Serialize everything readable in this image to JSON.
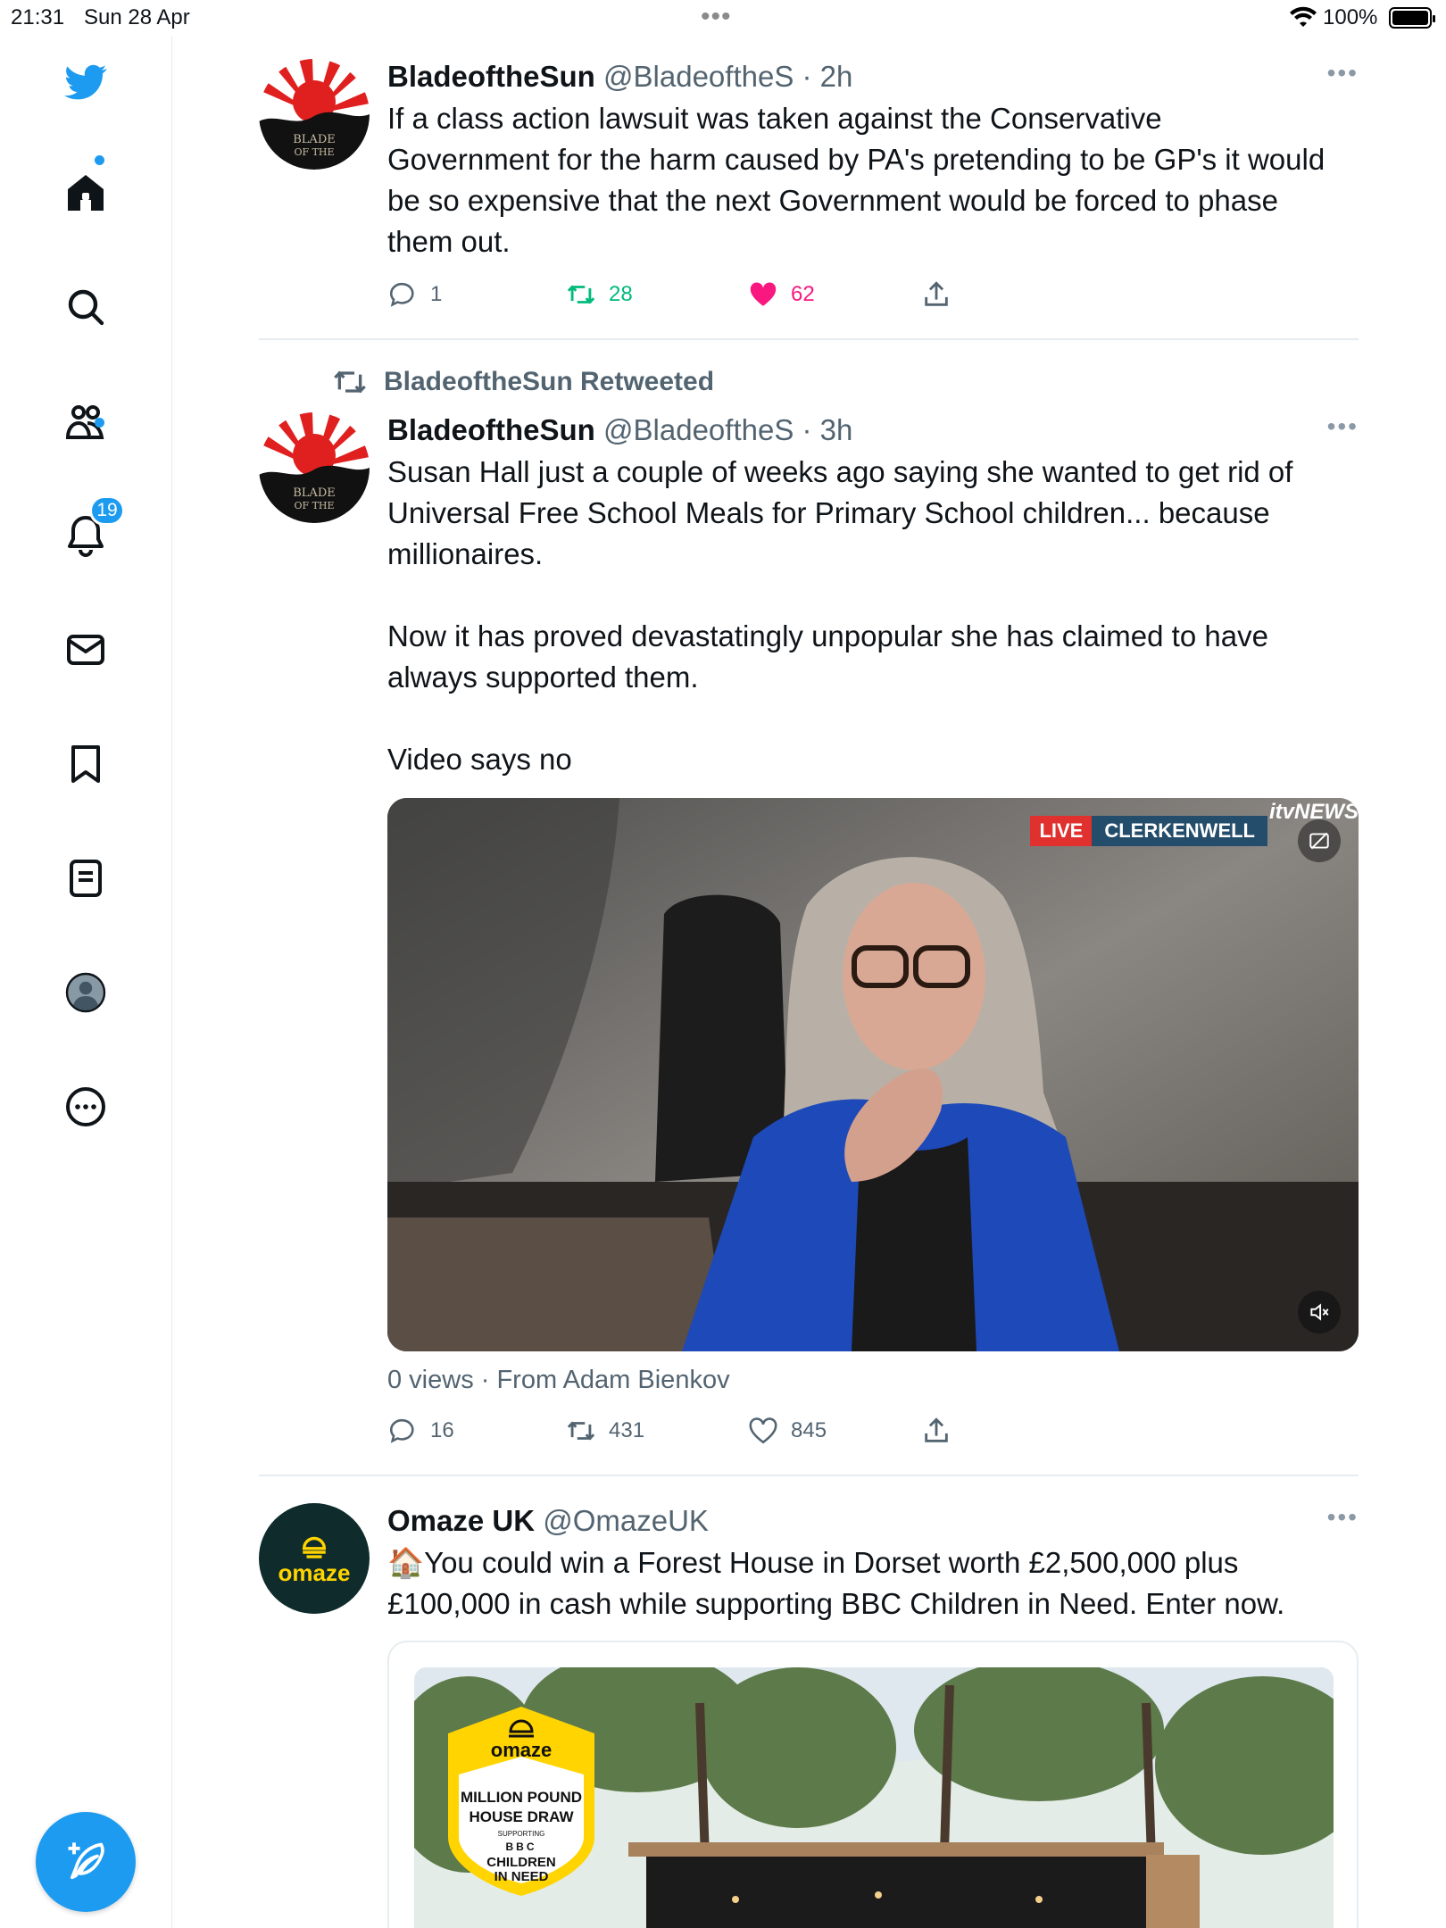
{
  "status": {
    "time": "21:31",
    "date": "Sun 28 Apr",
    "battery": "100%"
  },
  "sidebar": {
    "notifications_badge": "19",
    "items": [
      "twitter-logo",
      "home",
      "search",
      "communities",
      "notifications",
      "messages",
      "bookmarks",
      "lists",
      "profile",
      "more"
    ]
  },
  "tweets": [
    {
      "name": "BladeoftheSun",
      "handle": "@BladeoftheS",
      "sep": "·",
      "time": "2h",
      "text": "If a class action lawsuit was taken against the Conservative\nGovernment for the harm caused by PA's pretending to be GP's it would\nbe so expensive that the next Government would be forced to phase\nthem out.",
      "replies": "1",
      "retweets": "28",
      "likes": "62",
      "liked": true,
      "retweeted": true
    },
    {
      "retweet_label": "BladeoftheSun Retweeted",
      "name": "BladeoftheSun",
      "handle": "@BladeoftheS",
      "sep": "·",
      "time": "3h",
      "text": "Susan Hall just a couple of weeks ago saying she wanted to get rid of\nUniversal Free School Meals for Primary School children... because\nmillionaires.\n\nNow it has proved devastatingly unpopular she has claimed to have\nalways supported them.\n\nVideo says no",
      "video": {
        "live": "LIVE",
        "location": "CLERKENWELL",
        "logo": "itvNEWS"
      },
      "video_meta": "0 views · From Adam Bienkov",
      "replies": "16",
      "retweets": "431",
      "likes": "845"
    },
    {
      "name": "Omaze UK",
      "handle": "@OmazeUK",
      "avatar_text": "omaze",
      "text": "🏠You could win a Forest House in Dorset worth £2,500,000 plus\n£100,000 in cash while supporting BBC Children in Need. Enter now.",
      "ad_badge": {
        "brand": "omaze",
        "line1": "MILLION POUND",
        "line2": "HOUSE DRAW",
        "supporting": "SUPPORTING",
        "bbc": "BBC",
        "line3": "CHILDREN",
        "line4": "IN NEED"
      }
    }
  ],
  "colors": {
    "accent": "#1d9bf0",
    "like": "#f91880",
    "retweet": "#00ba7c",
    "secondary_text": "#536471"
  }
}
